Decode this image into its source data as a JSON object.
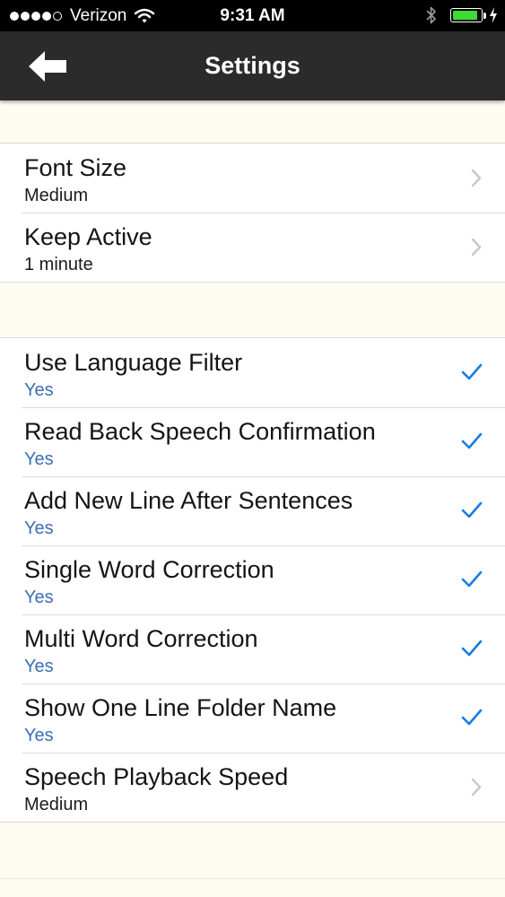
{
  "status_bar": {
    "carrier": "Verizon",
    "time": "9:31 AM",
    "signal_dots": 5,
    "signal_filled": 4,
    "battery_level": 0.9,
    "battery_color": "#3ddc32"
  },
  "nav": {
    "title": "Settings",
    "back_icon": "back-arrow-icon"
  },
  "groups": [
    {
      "rows": [
        {
          "title": "Font Size",
          "value": "Medium",
          "accessory": "chevron"
        },
        {
          "title": "Keep Active",
          "value": "1 minute",
          "accessory": "chevron"
        }
      ]
    },
    {
      "rows": [
        {
          "title": "Use Language Filter",
          "value": "Yes",
          "accessory": "checkmark"
        },
        {
          "title": "Read Back Speech Confirmation",
          "value": "Yes",
          "accessory": "checkmark"
        },
        {
          "title": "Add New Line After Sentences",
          "value": "Yes",
          "accessory": "checkmark"
        },
        {
          "title": "Single Word Correction",
          "value": "Yes",
          "accessory": "checkmark"
        },
        {
          "title": "Multi Word Correction",
          "value": "Yes",
          "accessory": "checkmark"
        },
        {
          "title": "Show One Line Folder Name",
          "value": "Yes",
          "accessory": "checkmark"
        },
        {
          "title": "Speech Playback Speed",
          "value": "Medium",
          "accessory": "chevron"
        }
      ]
    }
  ],
  "colors": {
    "value_blue": "#3e6db5",
    "checkmark_blue": "#1a7be0",
    "chevron_gray": "#c7c7cc",
    "nav_background": "#2b2b2b",
    "page_background": "#fefcf2"
  }
}
